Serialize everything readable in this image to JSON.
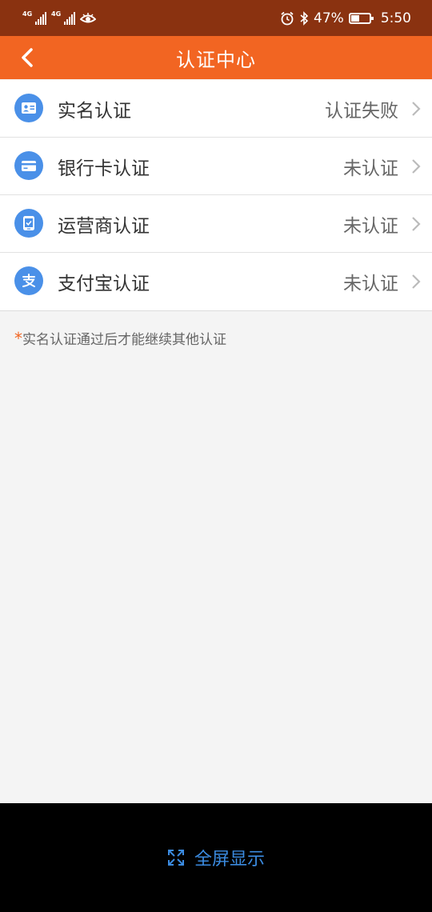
{
  "statusbar": {
    "net1": "4G",
    "net2": "4G",
    "battery_text": "47%",
    "battery_level": 0.47,
    "time": "5:50",
    "icons": [
      "signal-icon",
      "signal-icon",
      "eye-icon",
      "alarm-icon",
      "bluetooth-icon",
      "battery-icon"
    ]
  },
  "header": {
    "title": "认证中心",
    "back_icon": "chevron-left-icon"
  },
  "list": {
    "items": [
      {
        "label": "实名认证",
        "status": "认证失败",
        "icon": "id-card-icon"
      },
      {
        "label": "银行卡认证",
        "status": "未认证",
        "icon": "bank-card-icon"
      },
      {
        "label": "运营商认证",
        "status": "未认证",
        "icon": "phone-check-icon"
      },
      {
        "label": "支付宝认证",
        "status": "未认证",
        "icon": "alipay-icon"
      }
    ]
  },
  "note": {
    "star": "*",
    "text": "实名认证通过后才能继续其他认证"
  },
  "bottombar": {
    "fullscreen_label": "全屏显示",
    "icon": "expand-icon"
  },
  "colors": {
    "statusbar_bg": "#8a3210",
    "header_bg": "#f26522",
    "icon_bg": "#4a90e8",
    "fullscreen_text": "#3b8be0"
  }
}
